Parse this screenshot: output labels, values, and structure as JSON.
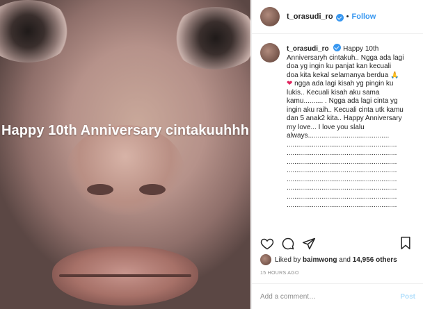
{
  "photo": {
    "overlay_text": "Happy 10th Anniversary cintakuuhhh"
  },
  "header": {
    "username": "t_orasudi_ro",
    "separator": "•",
    "follow_label": "Follow"
  },
  "caption": {
    "username": "t_orasudi_ro",
    "line1": "Happy 10th",
    "line2": "Anniversaryh cintakuh.. Ngga ada lagi",
    "line3": "doa yg ingin ku panjat kan kecuali",
    "line4": "doa kita kekal selamanya berdua",
    "line5_after_heart": "ngga ada lagi kisah yg pingin ku",
    "line6": "lukis.. Kecuali kisah aku sama",
    "line7": "kamu.......... . Ngga ada lagi cinta yg",
    "line8": "ingin aku raih.. Kecuali cinta utk kamu",
    "line9": "dan 5 anak2 kita.. Happy Anniversary",
    "line10": "my love... I love you slalu",
    "line11": "always..........................................",
    "dots1": ".........................................................",
    "dots2": ".........................................................",
    "dots3": ".........................................................",
    "dots4": ".........................................................",
    "dots5": ".........................................................",
    "dots6": ".........................................................",
    "dots7": ".........................................................",
    "dots8": "........................................................."
  },
  "likes": {
    "prefix": "Liked by",
    "user": "baimwong",
    "middle": "and",
    "count": "14,956 others"
  },
  "timestamp": "15 HOURS AGO",
  "comment": {
    "placeholder": "Add a comment…",
    "post_label": "Post"
  },
  "colors": {
    "accent": "#3897f0",
    "heart": "#e0245e",
    "post_disabled": "#b2dffc"
  }
}
